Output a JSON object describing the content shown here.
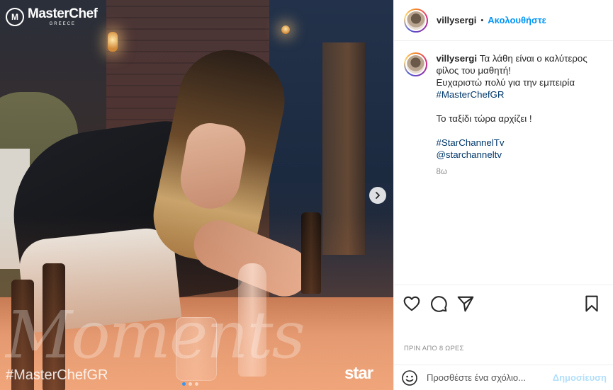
{
  "media": {
    "logo_badge": "M",
    "logo_name": "MasterChef",
    "logo_sub": "GREECE",
    "watermark_word": "Moments",
    "hashtag_overlay": "#MasterChefGR",
    "channel_logo": "star",
    "carousel_dots": 3,
    "active_dot": 0
  },
  "post": {
    "username": "villysergi",
    "bullet": "•",
    "follow_label": "Ακολουθήστε",
    "caption": {
      "username": "villysergi",
      "line1": "Τα λάθη είναι ο καλύτερος φίλος του μαθητή!",
      "line2": "Ευχαριστώ πολύ για την εμπειρία",
      "tag1": "#MasterChefGR",
      "line3": "Το ταξίδι τώρα αρχίζει !",
      "tag2": "#StarChannelTv",
      "mention": "@starchanneltv",
      "age": "8ω"
    },
    "date": "ΠΡΙΝ ΑΠΟ 8 ΩΡΕΣ",
    "comment_placeholder": "Προσθέστε ένα σχόλιο...",
    "post_label": "Δημοσίευση"
  },
  "icons": {
    "like": "heart-icon",
    "comment": "comment-icon",
    "share": "share-icon",
    "save": "bookmark-icon",
    "emoji": "emoji-icon",
    "next": "chevron-right-icon"
  },
  "colors": {
    "link": "#0095f6",
    "hashtag": "#00376b",
    "muted": "#8e8e8e"
  }
}
